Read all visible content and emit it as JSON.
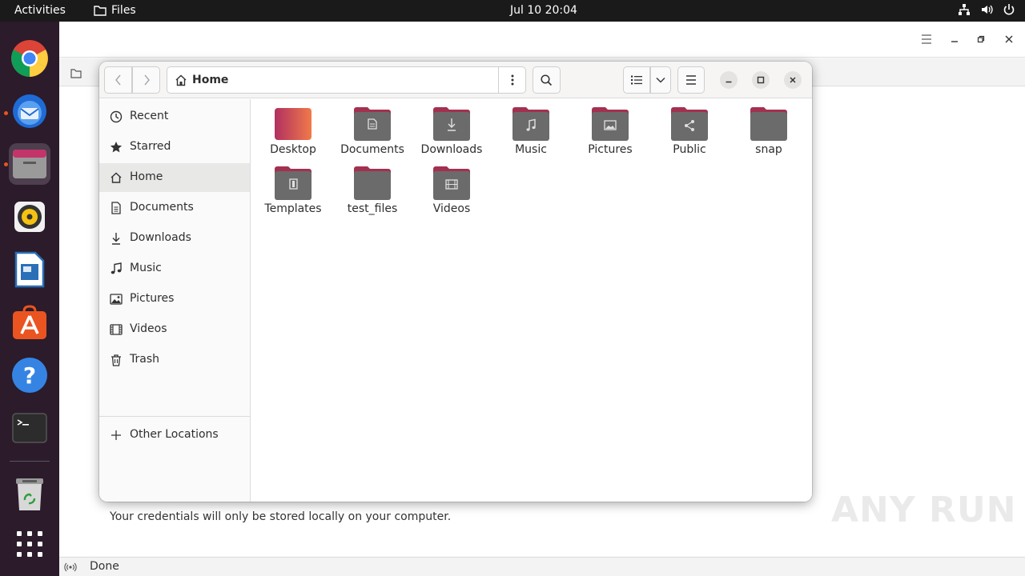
{
  "topbar": {
    "activities": "Activities",
    "app_name": "Files",
    "clock": "Jul 10  20:04"
  },
  "dock": {
    "apps": [
      "chrome-icon",
      "thunderbird-icon",
      "files-icon",
      "rhythmbox-icon",
      "writer-icon",
      "app-center-icon",
      "help-icon",
      "terminal-icon",
      "trash-icon",
      "show-apps-icon"
    ]
  },
  "background_window": {
    "credentials_note": "Your credentials will only be stored locally on your computer.",
    "status": "Done"
  },
  "files_window": {
    "path": "Home",
    "sidebar": [
      {
        "label": "Recent",
        "icon": "clock-icon"
      },
      {
        "label": "Starred",
        "icon": "star-icon"
      },
      {
        "label": "Home",
        "icon": "home-icon",
        "active": true
      },
      {
        "label": "Documents",
        "icon": "document-icon"
      },
      {
        "label": "Downloads",
        "icon": "download-icon"
      },
      {
        "label": "Music",
        "icon": "music-icon"
      },
      {
        "label": "Pictures",
        "icon": "picture-icon"
      },
      {
        "label": "Videos",
        "icon": "video-icon"
      },
      {
        "label": "Trash",
        "icon": "trash-icon"
      }
    ],
    "other_locations": "Other Locations",
    "items": [
      {
        "name": "Desktop",
        "icon": "desktop-folder-icon"
      },
      {
        "name": "Documents",
        "icon": "documents-folder-icon"
      },
      {
        "name": "Downloads",
        "icon": "downloads-folder-icon"
      },
      {
        "name": "Music",
        "icon": "music-folder-icon"
      },
      {
        "name": "Pictures",
        "icon": "pictures-folder-icon"
      },
      {
        "name": "Public",
        "icon": "public-folder-icon"
      },
      {
        "name": "snap",
        "icon": "folder-icon"
      },
      {
        "name": "Templates",
        "icon": "templates-folder-icon"
      },
      {
        "name": "test_files",
        "icon": "folder-icon"
      },
      {
        "name": "Videos",
        "icon": "videos-folder-icon"
      }
    ]
  },
  "watermark": "ANY RUN",
  "colors": {
    "topbar": "#1a1a1a",
    "dock": "#2b1b2b",
    "accent": "#e95420",
    "folder_tab": "#a3304f",
    "folder_body": "#6b6b6b"
  }
}
